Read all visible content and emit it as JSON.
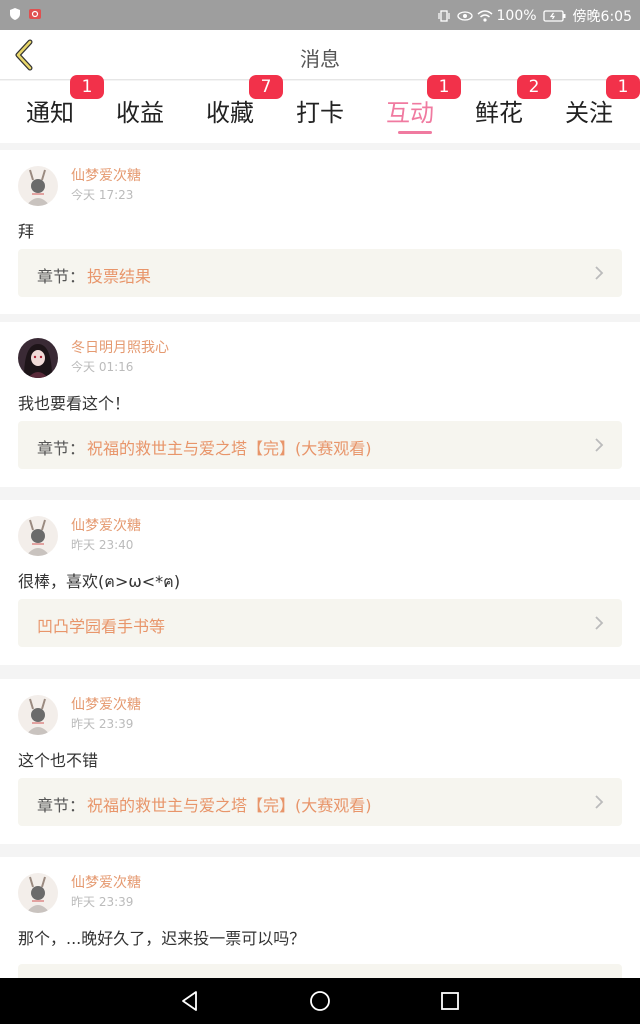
{
  "status_bar": {
    "battery": "100%",
    "time": "傍晚6:05"
  },
  "header": {
    "title": "消息"
  },
  "tabs": [
    {
      "label": "通知",
      "badge": "1"
    },
    {
      "label": "收益",
      "badge": ""
    },
    {
      "label": "收藏",
      "badge": "7"
    },
    {
      "label": "打卡",
      "badge": ""
    },
    {
      "label": "互动",
      "badge": "1",
      "active": true
    },
    {
      "label": "鲜花",
      "badge": "2"
    },
    {
      "label": "关注",
      "badge": "1"
    }
  ],
  "messages": [
    {
      "user": "仙梦爱次糖",
      "time": "今天 17:23",
      "text": "拜",
      "ref_prefix": "章节：",
      "ref_title": "投票结果"
    },
    {
      "user": "冬日明月照我心",
      "time": "今天 01:16",
      "text": "我也要看这个！",
      "ref_prefix": "章节：",
      "ref_title": "祝福的救世主与爱之塔【完】(大赛观看)"
    },
    {
      "user": "仙梦爱次糖",
      "time": "昨天 23:40",
      "text": "很棒，喜欢(ฅ>ω<*ฅ)",
      "ref_prefix": "",
      "ref_title": "凹凸学园看手书等"
    },
    {
      "user": "仙梦爱次糖",
      "time": "昨天 23:39",
      "text": "这个也不错",
      "ref_prefix": "章节：",
      "ref_title": "祝福的救世主与爱之塔【完】(大赛观看)"
    },
    {
      "user": "仙梦爱次糖",
      "time": "昨天 23:39",
      "text": "那个，...晚好久了，迟来投一票可以吗？",
      "ref_prefix": "",
      "ref_title": ""
    }
  ],
  "colors": {
    "accent": "#f07aa0",
    "badge": "#f2314a",
    "username": "#e59a71",
    "link": "#e8956a"
  }
}
